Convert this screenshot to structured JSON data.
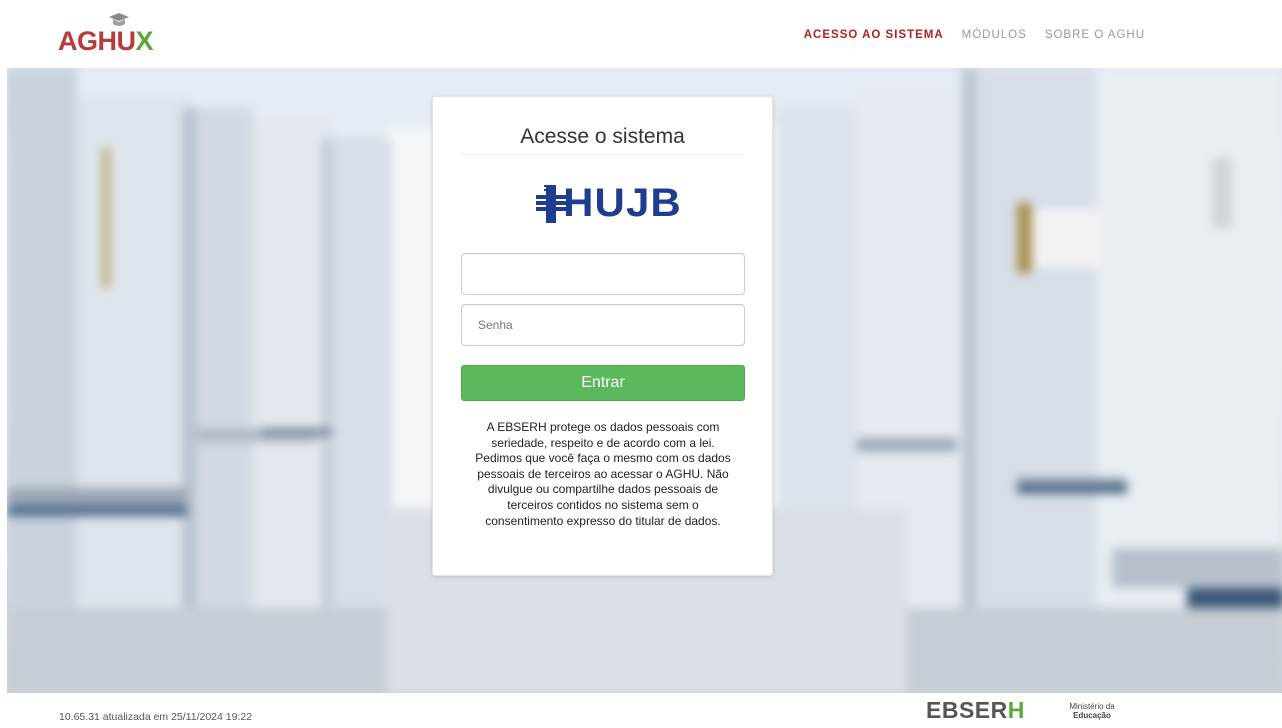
{
  "header": {
    "logo_text_main": "AGHU",
    "logo_text_x": "X",
    "nav": [
      {
        "label": "ACESSO AO SISTEMA",
        "active": true
      },
      {
        "label": "MÓDULOS",
        "active": false
      },
      {
        "label": "SOBRE O AGHU",
        "active": false
      }
    ]
  },
  "login": {
    "title": "Acesse o sistema",
    "hospital_logo_text": "HUJB",
    "username_value": "",
    "username_placeholder": "",
    "password_placeholder": "Senha",
    "submit_label": "Entrar",
    "notice": "A EBSERH protege os dados pessoais com seriedade, respeito e de acordo com a lei. Pedimos que você faça o mesmo com os dados pessoais de terceiros ao acessar o AGHU. Não divulgue ou compartilhe dados pessoais de terceiros contidos no sistema sem o consentimento expresso do titular de dados."
  },
  "footer": {
    "version_text": "10.65.31 atualizada em 25/11/2024 19:22",
    "ebserh_main": "EBSER",
    "ebserh_h": "H",
    "ministry_line1": "Ministério da",
    "ministry_line2": "Educação"
  },
  "colors": {
    "brand_red": "#b83a3a",
    "brand_green": "#5ea63a",
    "nav_active": "#b12121",
    "button_green": "#5cb85c",
    "hujb_blue": "#1f3d8f"
  }
}
